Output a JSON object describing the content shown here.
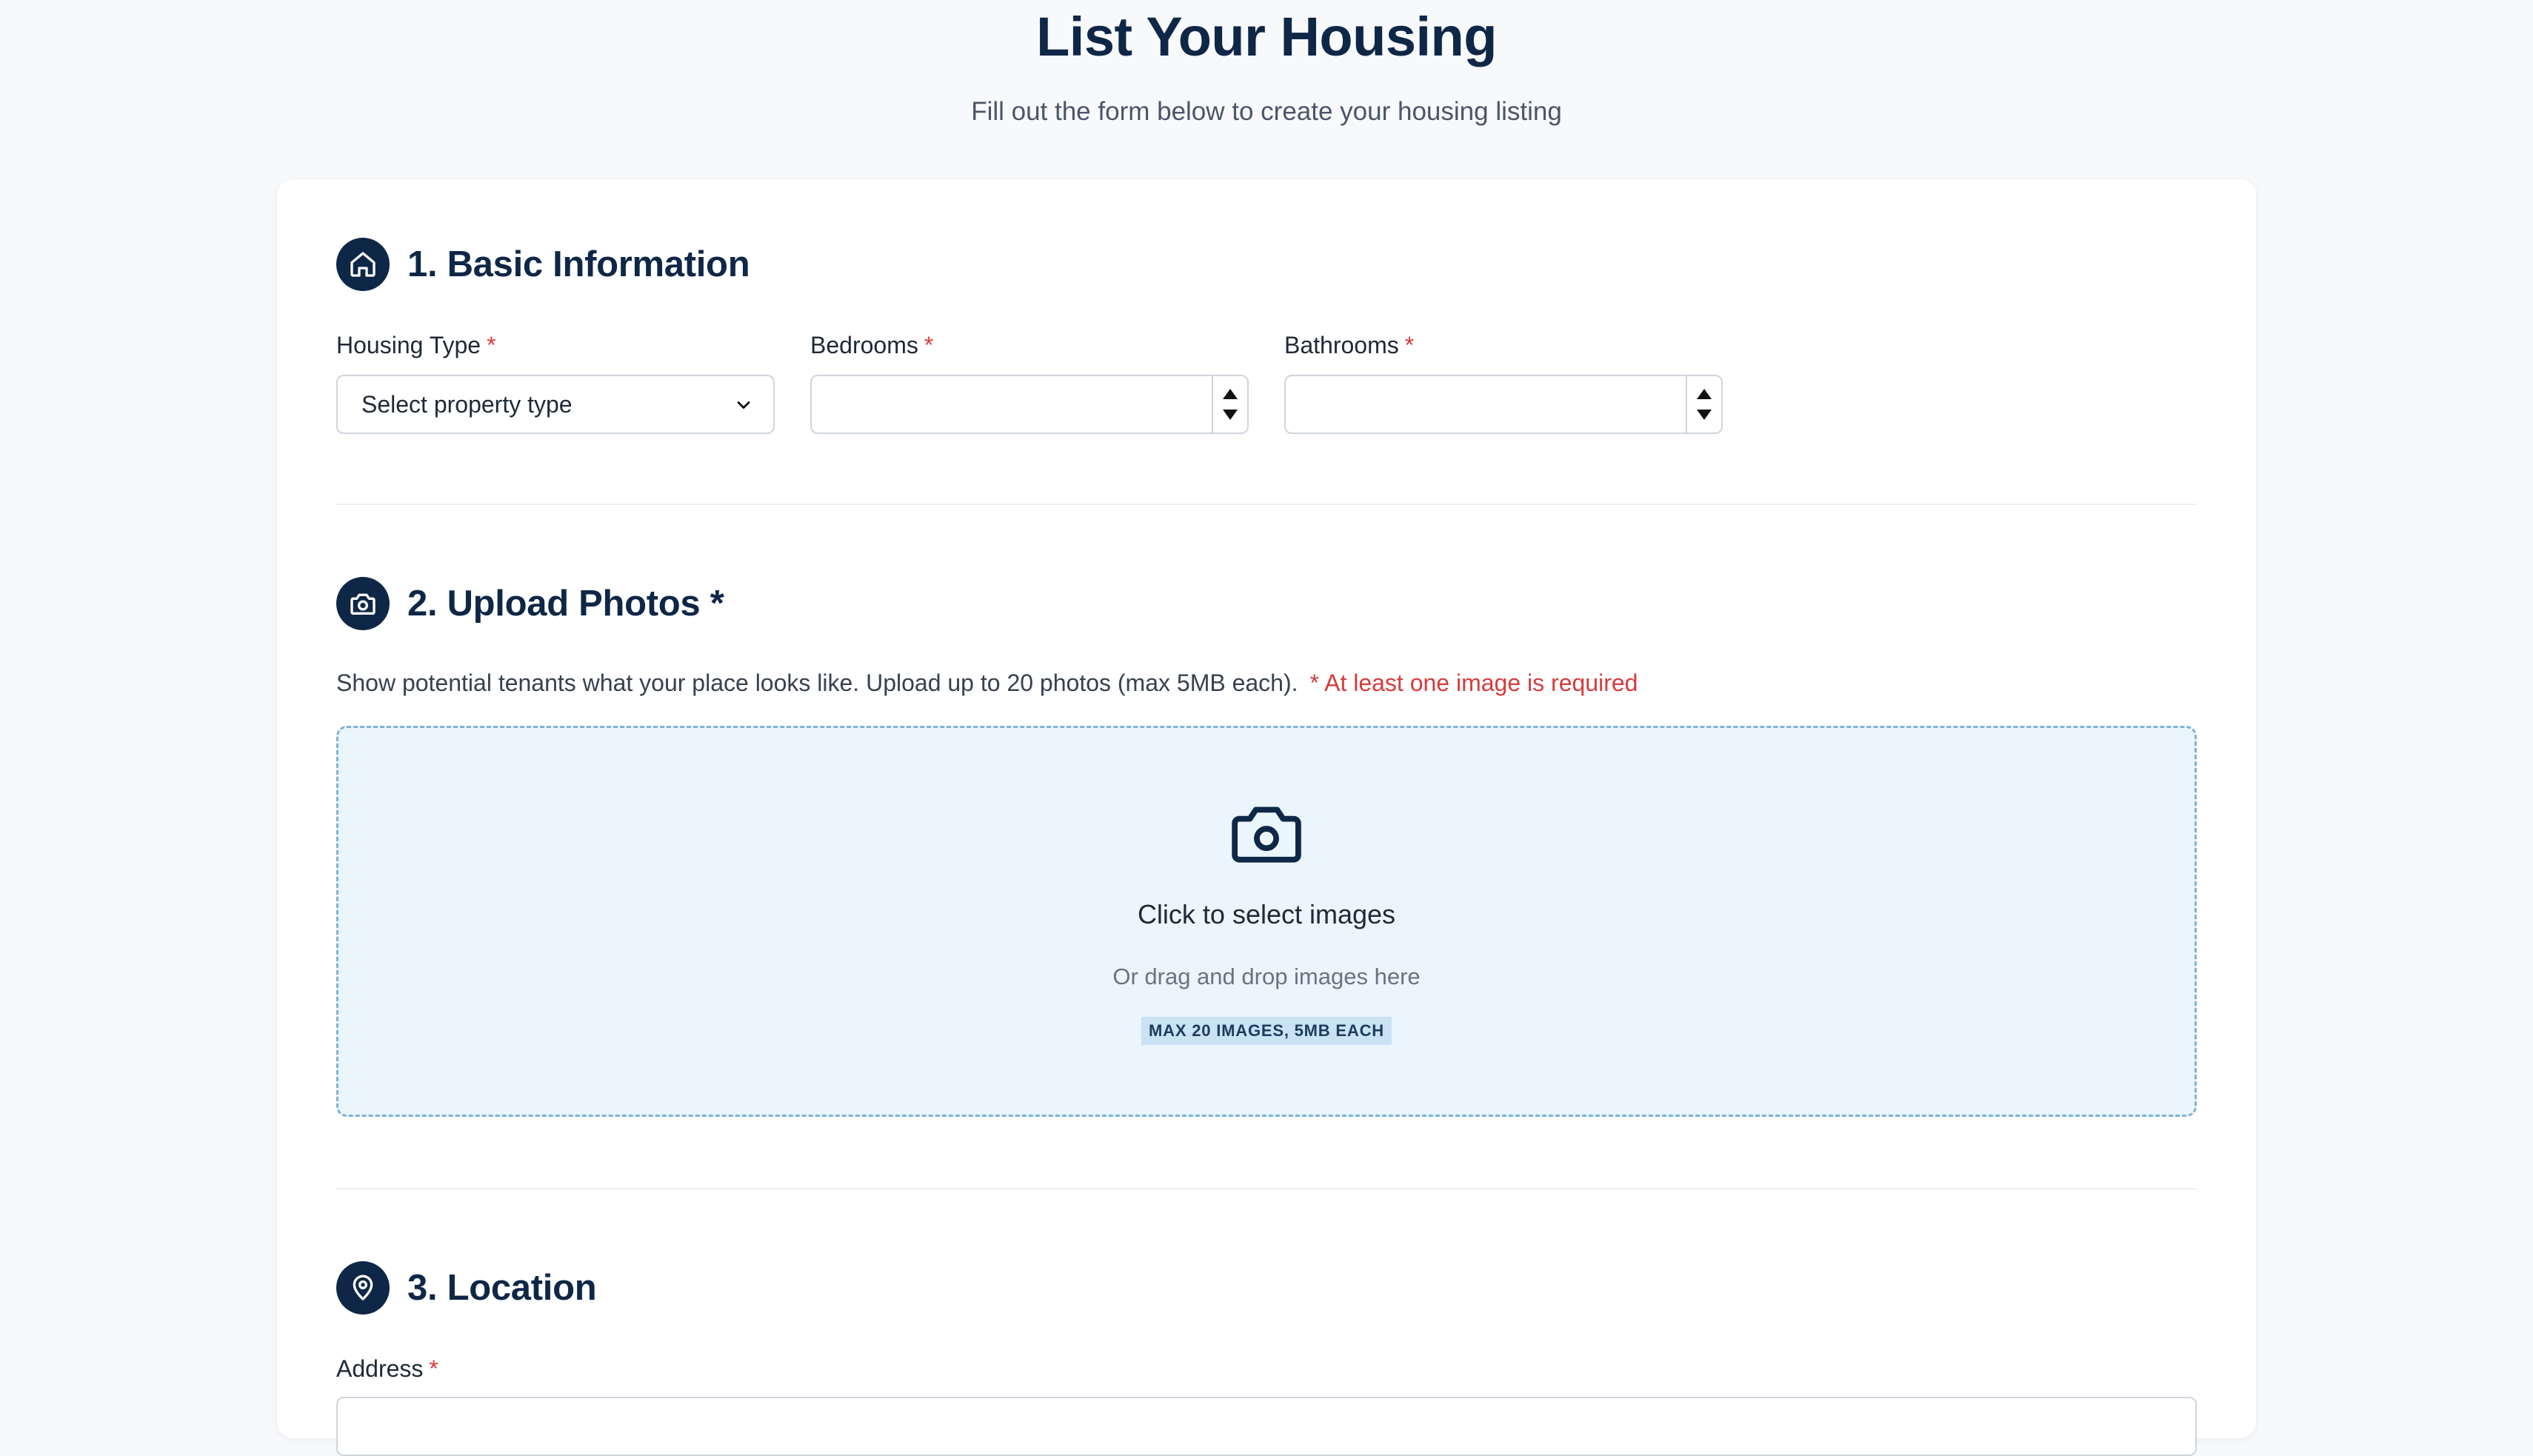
{
  "header": {
    "title": "List Your Housing",
    "subtitle": "Fill out the form below to create your housing listing"
  },
  "sections": {
    "basic": {
      "title": "1. Basic Information",
      "icon": "home-icon",
      "housing_type": {
        "label": "Housing Type",
        "required_mark": "*",
        "selected": "Select property type"
      },
      "bedrooms": {
        "label": "Bedrooms",
        "required_mark": "*",
        "value": ""
      },
      "bathrooms": {
        "label": "Bathrooms",
        "required_mark": "*",
        "value": ""
      }
    },
    "photos": {
      "title": "2. Upload Photos *",
      "icon": "camera-icon",
      "description": "Show potential tenants what your place looks like. Upload up to 20 photos (max 5MB each).",
      "error": "* At least one image is required",
      "dropzone": {
        "title": "Click to select images",
        "subtitle": "Or drag and drop images here",
        "badge": "MAX 20 IMAGES, 5MB EACH"
      }
    },
    "location": {
      "title": "3. Location",
      "icon": "map-pin-icon",
      "address": {
        "label": "Address",
        "required_mark": "*",
        "value": ""
      }
    }
  },
  "colors": {
    "primary": "#0f2747",
    "required": "#dc3a3a",
    "dropzone_bg": "#eaf5fc",
    "dropzone_border": "#7fb2d8",
    "badge_bg": "#c9e2f4",
    "page_bg": "#f7f9fb"
  }
}
